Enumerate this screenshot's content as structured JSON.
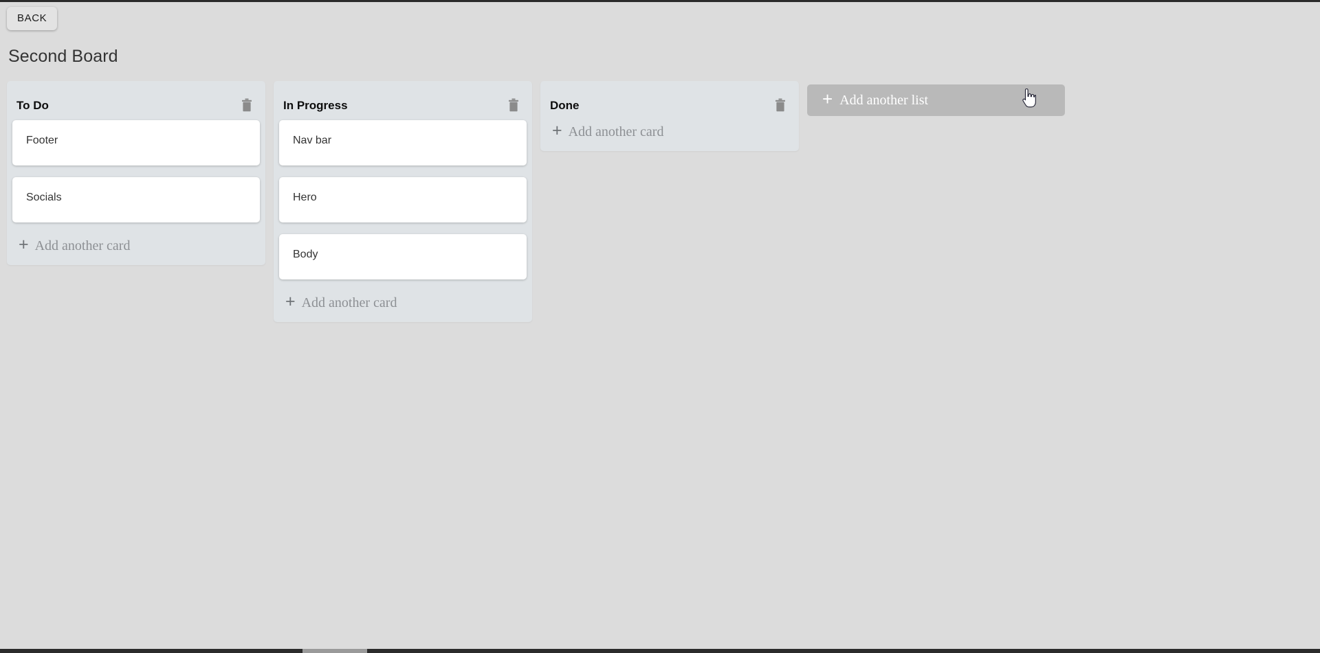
{
  "page": {
    "background_color": "#dcdcdc",
    "board_title": "Second Board"
  },
  "topbar": {
    "back_label": "BACK"
  },
  "board": {
    "lists": [
      {
        "title": "To Do",
        "delete_icon": "trash-icon",
        "cards": [
          {
            "text": "Footer"
          },
          {
            "text": "Socials"
          }
        ],
        "add_card_label": "Add another card",
        "add_card_icon": "plus-icon"
      },
      {
        "title": "In Progress",
        "delete_icon": "trash-icon",
        "cards": [
          {
            "text": "Nav bar"
          },
          {
            "text": "Hero"
          },
          {
            "text": "Body"
          }
        ],
        "add_card_label": "Add another card",
        "add_card_icon": "plus-icon"
      },
      {
        "title": "Done",
        "delete_icon": "trash-icon",
        "cards": [],
        "add_card_label": "Add another card",
        "add_card_icon": "plus-icon"
      }
    ],
    "add_list": {
      "label": "Add another list",
      "icon": "plus-icon",
      "plus_glyph": "+",
      "background_color": "#b9b9b9",
      "text_color": "#ffffff"
    }
  },
  "icons": {
    "plus_glyph": "+"
  },
  "colors": {
    "page_background": "#dcdcdc",
    "list_background": "#dfe3e6",
    "card_background": "#ffffff",
    "card_text": "#333333",
    "muted_text": "#8d9094",
    "trash_icon": "#8b8b8b",
    "add_list_button": "#b9b9b9"
  },
  "scrollbar": {
    "orientation": "horizontal",
    "track_color": "#2b2b2b",
    "thumb_color": "#9a9a9a"
  }
}
